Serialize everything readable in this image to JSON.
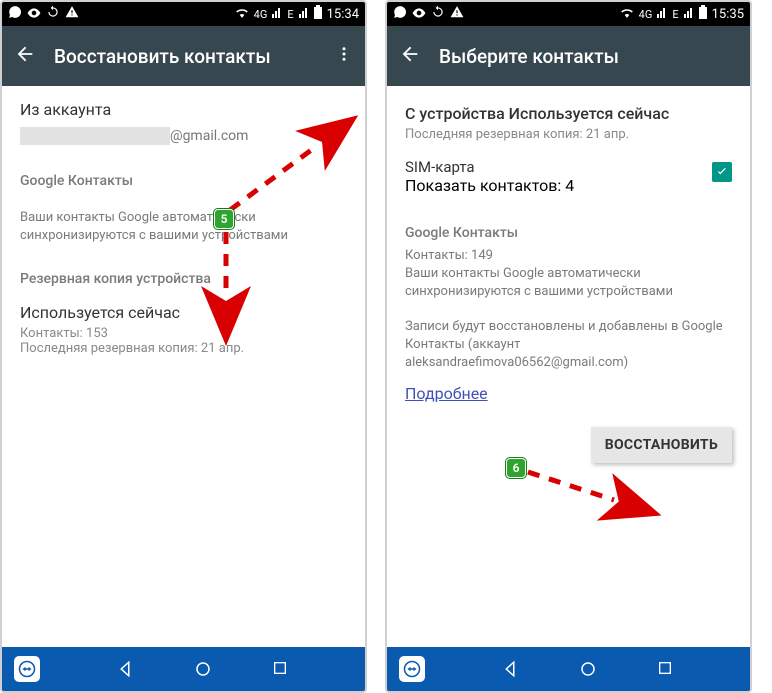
{
  "left": {
    "status": {
      "time": "15:34",
      "net": "4G"
    },
    "titlebar": {
      "title": "Восстановить контакты"
    },
    "account": {
      "label": "Из аккаунта",
      "email_tail": "@gmail.com"
    },
    "google": {
      "head": "Google Контакты",
      "desc": "Ваши контакты Google автоматически синхронизируются с вашими устройствами"
    },
    "backup": {
      "head": "Резервная копия устройства",
      "device_title": "Используется сейчас",
      "contacts": "Контакты: 153",
      "last": "Последняя резервная копия: 21 апр."
    }
  },
  "right": {
    "status": {
      "time": "15:35",
      "net": "4G"
    },
    "titlebar": {
      "title": "Выберите контакты"
    },
    "device": {
      "title": "С устройства Используется сейчас",
      "last": "Последняя резервная копия: 21 апр."
    },
    "sim": {
      "title": "SIM-карта",
      "count": "Показать контактов: 4"
    },
    "google": {
      "head": "Google Контакты",
      "count": "Контакты: 149",
      "desc": "Ваши контакты Google автоматически синхронизируются с вашими устройствами"
    },
    "info": {
      "text": "Записи будут восстановлены и добавлены в Google Контакты (аккаунт aleksandraefimova06562@gmail.com)",
      "link": "Подробнее"
    },
    "restore_btn": "ВОССТАНОВИТЬ"
  },
  "badges": {
    "five": "5",
    "six": "6"
  }
}
